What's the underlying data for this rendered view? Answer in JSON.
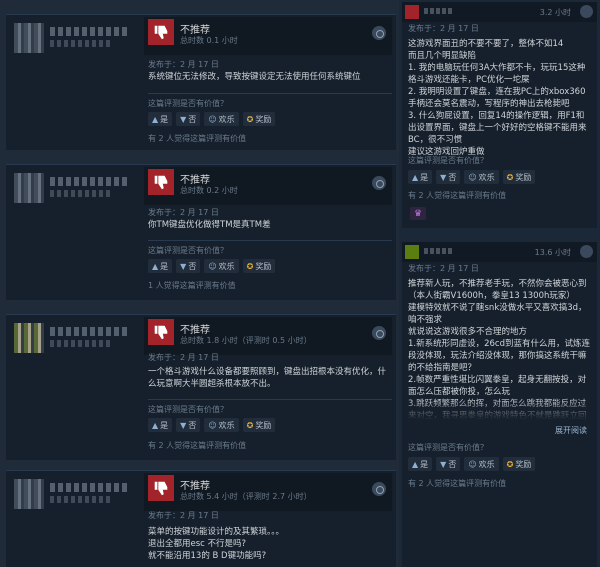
{
  "left_reviews": [
    {
      "verdict": "不推荐",
      "hours": "总时数 0.1 小时",
      "posted": "发布于：2 月 17 日",
      "body": "系统键位无法修改，导致按键设定无法使用任何系统键位",
      "helpful_q": "这篇评测是否有价值？",
      "buttons": [
        "是",
        "否",
        "欢乐",
        "奖励"
      ],
      "helpful_count": "有 2 人觉得这篇评测有价值"
    },
    {
      "verdict": "不推荐",
      "hours": "总时数 0.2 小时",
      "posted": "发布于：2 月 17 日",
      "body": "你TM键盘优化做得TM是真TM差",
      "helpful_q": "这篇评测是否有价值？",
      "buttons": [
        "是",
        "否",
        "欢乐",
        "奖励"
      ],
      "helpful_count": "1 人觉得这篇评测有价值"
    },
    {
      "verdict": "不推荐",
      "hours": "总时数 1.8 小时（评测时 0.5 小时）",
      "posted": "发布于：2 月 17 日",
      "body": "一个格斗游戏什么设备都要照顾到，键盘出招根本没有优化，什么玩意啊大半圆超杀根本放不出。",
      "helpful_q": "这篇评测是否有价值？",
      "buttons": [
        "是",
        "否",
        "欢乐",
        "奖励"
      ],
      "helpful_count": "有 2 人觉得这篇评测有价值"
    },
    {
      "verdict": "不推荐",
      "hours": "总时数 5.4 小时（评测时 2.7 小时）",
      "posted": "发布于：2 月 17 日",
      "body_lines": [
        "菜单的按键功能设计的及其繁琐。。。",
        "退出全都用esc 不行是吗?",
        "就不能沿用13的 B D键功能吗?"
      ]
    }
  ],
  "right_reviews": [
    {
      "hours": "3.2 小时",
      "posted": "发布于：2 月 17 日",
      "body": "这游戏界面丑的不要不要了，整体不如14\n而且几个明显缺陷\n1. 我的电脑玩任何3A大作都不卡，玩玩15这种格斗游戏还能卡，PC优化一坨屎\n2. 我明明设置了键盘，连在我PC上的xbox360手柄还会莫名震动，写程序的神出去枪毙吧\n3. 什么狗屁设置，回复14的操作逻辑，用F1和出设置界面，键盘上一个好好的空格键不能用来BC，很不习惯\n建议这游戏回炉重做",
      "helpful_q": "这篇评测是否有价值？",
      "buttons": [
        "是",
        "否",
        "欢乐",
        "奖励"
      ],
      "helpful_count": "有 2 人觉得这篇评测有价值"
    },
    {
      "hours": "13.6 小时",
      "posted": "发布于：2 月 17 日",
      "body": "推荐新人玩，不推荐老手玩，不然你会被恶心到（本人街霸V1600h，拳皇13 1300h玩家）\n建模特效就不说了瞎snk没做水平又喜欢搞3d，咱不强求\n就说说这游戏很多不合理的地方\n1.新系统形同虚设，26cd到蓝有什么用，试炼连段没体现，玩法介绍没体现，那你搞这系统干嘛的不给指南是吧？\n2.帧数严重性堪比闪翼拳皇，起身无翻按投，对面怎么压都被你投，怎么玩\n3.跳跃频繁那么的挥，对面怎么跳我都能反应过来对空，我寻思拳皇的游戏特色不就是跳跃立回吗，你跳起来就挨打，那还立回个鸡巴",
      "expand": "展开阅读",
      "helpful_q": "这篇评测是否有价值？",
      "buttons": [
        "是",
        "否",
        "欢乐",
        "奖励"
      ],
      "helpful_count": "有 2 人觉得这篇评测有价值"
    }
  ],
  "colors": {
    "thumb_down": "#a3232b",
    "background": "#1b2838",
    "panel": "#16202d"
  }
}
